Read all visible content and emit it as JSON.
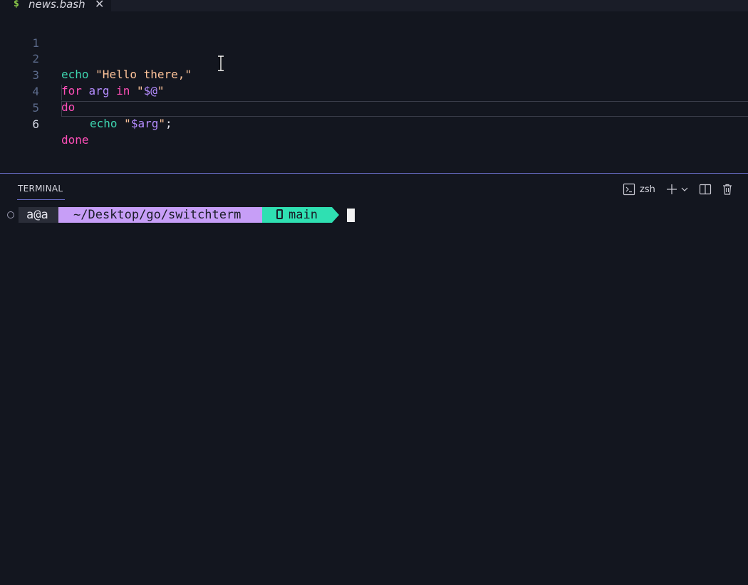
{
  "tab": {
    "icon": "$",
    "icon_name": "dollar-icon",
    "filename": "news.bash",
    "close_glyph": "✕"
  },
  "editor": {
    "lines": [
      {
        "number": "1"
      },
      {
        "number": "2",
        "tokens": [
          "echo",
          "\"Hello there,\""
        ]
      },
      {
        "number": "3",
        "tokens": [
          "for",
          "arg",
          "in",
          "\"",
          "$@",
          "\""
        ]
      },
      {
        "number": "4",
        "tokens": [
          "do"
        ]
      },
      {
        "number": "5",
        "tokens": [
          "echo",
          "\"",
          "$arg",
          "\"",
          ";"
        ]
      },
      {
        "number": "6",
        "tokens": [
          "done"
        ]
      }
    ],
    "active_line": "6"
  },
  "panel": {
    "tab_label": "TERMINAL",
    "shell_label": "zsh",
    "icons": [
      "terminal-icon",
      "plus-icon",
      "chevron-down-icon",
      "split-icon",
      "trash-icon"
    ]
  },
  "prompt": {
    "user": "a@a",
    "path": "~/Desktop/go/switchterm",
    "branch": "main"
  },
  "colors": {
    "background": "#13161f",
    "accent": "#6a6ec8",
    "builtin": "#3ed6b0",
    "keyword": "#ff4fb8",
    "variable": "#b58cff",
    "string": "#ffc49a",
    "path_segment": "#c79ef7",
    "branch_segment": "#2fe0b2"
  }
}
